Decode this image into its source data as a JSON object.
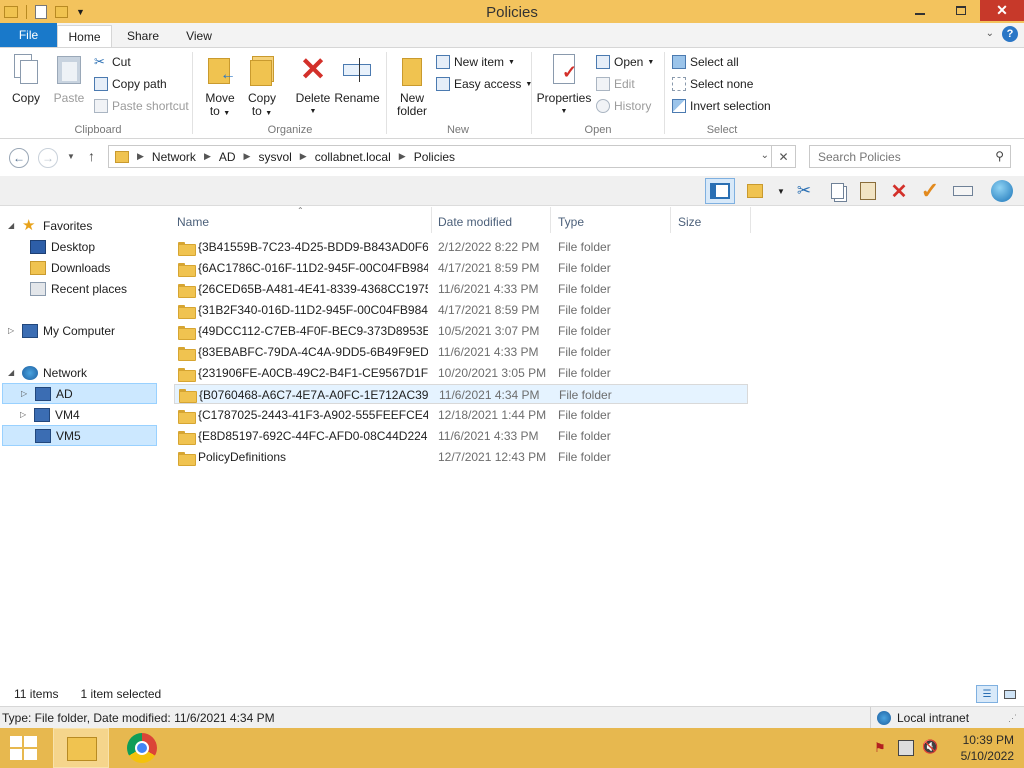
{
  "window": {
    "title": "Policies"
  },
  "ribbon_tabs": [
    "File",
    "Home",
    "Share",
    "View"
  ],
  "clipboard": {
    "copy": "Copy",
    "paste": "Paste",
    "cut": "Cut",
    "copy_path": "Copy path",
    "paste_shortcut": "Paste shortcut",
    "label": "Clipboard"
  },
  "organize": {
    "move_to_1": "Move",
    "move_to_2": "to",
    "copy_to_1": "Copy",
    "copy_to_2": "to",
    "delete": "Delete",
    "rename": "Rename",
    "label": "Organize"
  },
  "new_group": {
    "new_folder_1": "New",
    "new_folder_2": "folder",
    "new_item": "New item",
    "easy_access": "Easy access",
    "label": "New"
  },
  "open_group": {
    "properties": "Properties",
    "open": "Open",
    "edit": "Edit",
    "history": "History",
    "label": "Open"
  },
  "select_group": {
    "select_all": "Select all",
    "select_none": "Select none",
    "invert": "Invert selection",
    "label": "Select"
  },
  "address": {
    "crumbs": [
      "Network",
      "AD",
      "sysvol",
      "collabnet.local",
      "Policies"
    ]
  },
  "search": {
    "placeholder": "Search Policies"
  },
  "nav": {
    "favorites": "Favorites",
    "desktop": "Desktop",
    "downloads": "Downloads",
    "recent": "Recent places",
    "computer": "My Computer",
    "network": "Network",
    "ad": "AD",
    "vm4": "VM4",
    "vm5": "VM5"
  },
  "columns": {
    "name": "Name",
    "date": "Date modified",
    "type": "Type",
    "size": "Size"
  },
  "files": [
    {
      "name": "{3B41559B-7C23-4D25-BDD9-B843AD0F6...",
      "date": "2/12/2022 8:22 PM",
      "type": "File folder"
    },
    {
      "name": "{6AC1786C-016F-11D2-945F-00C04FB984...",
      "date": "4/17/2021 8:59 PM",
      "type": "File folder"
    },
    {
      "name": "{26CED65B-A481-4E41-8339-4368CC1975...",
      "date": "11/6/2021 4:33 PM",
      "type": "File folder"
    },
    {
      "name": "{31B2F340-016D-11D2-945F-00C04FB984...",
      "date": "4/17/2021 8:59 PM",
      "type": "File folder"
    },
    {
      "name": "{49DCC112-C7EB-4F0F-BEC9-373D8953E...",
      "date": "10/5/2021 3:07 PM",
      "type": "File folder"
    },
    {
      "name": "{83EBABFC-79DA-4C4A-9DD5-6B49F9ED...",
      "date": "11/6/2021 4:33 PM",
      "type": "File folder"
    },
    {
      "name": "{231906FE-A0CB-49C2-B4F1-CE9567D1F0...",
      "date": "10/20/2021 3:05 PM",
      "type": "File folder"
    },
    {
      "name": "{B0760468-A6C7-4E7A-A0FC-1E712AC39...",
      "date": "11/6/2021 4:34 PM",
      "type": "File folder"
    },
    {
      "name": "{C1787025-2443-41F3-A902-555FEEFCE4...",
      "date": "12/18/2021 1:44 PM",
      "type": "File folder"
    },
    {
      "name": "{E8D85197-692C-44FC-AFD0-08C44D224...",
      "date": "11/6/2021 4:33 PM",
      "type": "File folder"
    },
    {
      "name": "PolicyDefinitions",
      "date": "12/7/2021 12:43 PM",
      "type": "File folder"
    }
  ],
  "status": {
    "count": "11 items",
    "selected": "1 item selected",
    "details": "Type: File folder, Date modified: 11/6/2021 4:34 PM",
    "zone": "Local intranet"
  },
  "clock": {
    "time": "10:39 PM",
    "date": "5/10/2022"
  }
}
